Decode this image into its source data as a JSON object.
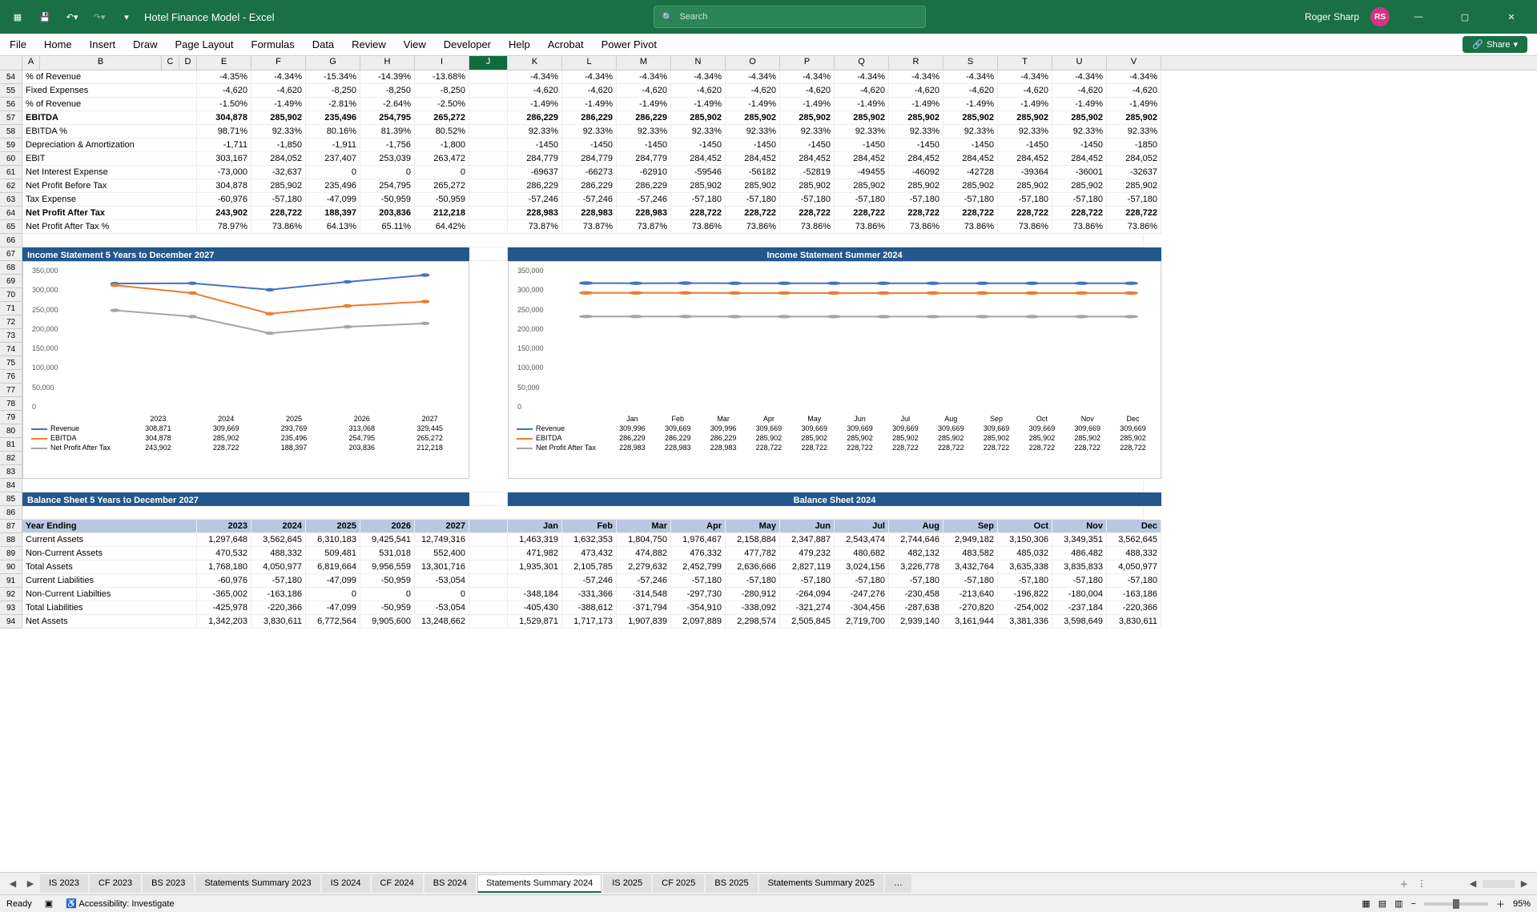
{
  "title_bar": {
    "app_name": "Hotel Finance Model  -  Excel",
    "search_placeholder": "Search",
    "user_name": "Roger Sharp",
    "user_initials": "RS"
  },
  "ribbon": {
    "tabs": [
      "File",
      "Home",
      "Insert",
      "Draw",
      "Page Layout",
      "Formulas",
      "Data",
      "Review",
      "View",
      "Developer",
      "Help",
      "Acrobat",
      "Power Pivot"
    ],
    "share_label": "Share"
  },
  "columns": {
    "letters": [
      "A",
      "B",
      "C",
      "D",
      "E",
      "F",
      "G",
      "H",
      "I",
      "J",
      "K",
      "L",
      "M",
      "N",
      "O",
      "P",
      "Q",
      "R",
      "S",
      "T",
      "U",
      "V"
    ],
    "widths": [
      22,
      152,
      22,
      22,
      68,
      68,
      68,
      68,
      68,
      48,
      68,
      68,
      68,
      68,
      68,
      68,
      68,
      68,
      68,
      68,
      68,
      68
    ],
    "selected": "J"
  },
  "row_numbers_top": [
    54,
    55,
    56,
    57,
    58,
    59,
    60,
    61,
    62,
    63,
    64,
    65,
    66,
    67,
    68,
    69,
    70,
    71,
    72,
    73,
    74,
    75,
    76,
    77,
    78,
    79,
    80,
    81,
    82,
    83,
    84,
    85,
    86,
    87,
    88,
    89,
    90,
    91,
    92,
    93,
    94
  ],
  "data_rows": [
    {
      "r": 54,
      "label": "% of Revenue",
      "vals": [
        "-4.35%",
        "-4.34%",
        "-15.34%",
        "-14.39%",
        "-13.68%",
        "",
        "-4.34%",
        "-4.34%",
        "-4.34%",
        "-4.34%",
        "-4.34%",
        "-4.34%",
        "-4.34%",
        "-4.34%",
        "-4.34%",
        "-4.34%",
        "-4.34%",
        "-4.34%"
      ]
    },
    {
      "r": 55,
      "label": "Fixed Expenses",
      "vals": [
        "-4,620",
        "-4,620",
        "-8,250",
        "-8,250",
        "-8,250",
        "",
        "-4,620",
        "-4,620",
        "-4,620",
        "-4,620",
        "-4,620",
        "-4,620",
        "-4,620",
        "-4,620",
        "-4,620",
        "-4,620",
        "-4,620",
        "-4,620"
      ]
    },
    {
      "r": 56,
      "label": "% of Revenue",
      "vals": [
        "-1.50%",
        "-1.49%",
        "-2.81%",
        "-2.64%",
        "-2.50%",
        "",
        "-1.49%",
        "-1.49%",
        "-1.49%",
        "-1.49%",
        "-1.49%",
        "-1.49%",
        "-1.49%",
        "-1.49%",
        "-1.49%",
        "-1.49%",
        "-1.49%",
        "-1.49%"
      ]
    },
    {
      "r": 57,
      "label": "EBITDA",
      "bold": true,
      "vals": [
        "304,878",
        "285,902",
        "235,496",
        "254,795",
        "265,272",
        "",
        "286,229",
        "286,229",
        "286,229",
        "285,902",
        "285,902",
        "285,902",
        "285,902",
        "285,902",
        "285,902",
        "285,902",
        "285,902",
        "285,902"
      ]
    },
    {
      "r": 58,
      "label": "EBITDA %",
      "vals": [
        "98.71%",
        "92.33%",
        "80.16%",
        "81.39%",
        "80.52%",
        "",
        "92.33%",
        "92.33%",
        "92.33%",
        "92.33%",
        "92.33%",
        "92.33%",
        "92.33%",
        "92.33%",
        "92.33%",
        "92.33%",
        "92.33%",
        "92.33%"
      ]
    },
    {
      "r": 59,
      "label": "Depreciation & Amortization",
      "vals": [
        "-1,711",
        "-1,850",
        "-1,911",
        "-1,756",
        "-1,800",
        "",
        "-1450",
        "-1450",
        "-1450",
        "-1450",
        "-1450",
        "-1450",
        "-1450",
        "-1450",
        "-1450",
        "-1450",
        "-1450",
        "-1850"
      ]
    },
    {
      "r": 60,
      "label": "EBIT",
      "vals": [
        "303,167",
        "284,052",
        "237,407",
        "253,039",
        "263,472",
        "",
        "284,779",
        "284,779",
        "284,779",
        "284,452",
        "284,452",
        "284,452",
        "284,452",
        "284,452",
        "284,452",
        "284,452",
        "284,452",
        "284,052"
      ]
    },
    {
      "r": 61,
      "label": "Net Interest Expense",
      "vals": [
        "-73,000",
        "-32,637",
        "0",
        "0",
        "0",
        "",
        "-69637",
        "-66273",
        "-62910",
        "-59546",
        "-56182",
        "-52819",
        "-49455",
        "-46092",
        "-42728",
        "-39364",
        "-36001",
        "-32637"
      ]
    },
    {
      "r": 62,
      "label": "Net Profit Before Tax",
      "vals": [
        "304,878",
        "285,902",
        "235,496",
        "254,795",
        "265,272",
        "",
        "286,229",
        "286,229",
        "286,229",
        "285,902",
        "285,902",
        "285,902",
        "285,902",
        "285,902",
        "285,902",
        "285,902",
        "285,902",
        "285,902"
      ]
    },
    {
      "r": 63,
      "label": "Tax Expense",
      "vals": [
        "-60,976",
        "-57,180",
        "-47,099",
        "-50,959",
        "-50,959",
        "",
        "-57,246",
        "-57,246",
        "-57,246",
        "-57,180",
        "-57,180",
        "-57,180",
        "-57,180",
        "-57,180",
        "-57,180",
        "-57,180",
        "-57,180",
        "-57,180"
      ]
    },
    {
      "r": 64,
      "label": "Net Profit After Tax",
      "bold": true,
      "vals": [
        "243,902",
        "228,722",
        "188,397",
        "203,836",
        "212,218",
        "",
        "228,983",
        "228,983",
        "228,983",
        "228,722",
        "228,722",
        "228,722",
        "228,722",
        "228,722",
        "228,722",
        "228,722",
        "228,722",
        "228,722"
      ]
    },
    {
      "r": 65,
      "label": "Net Profit After Tax %",
      "vals": [
        "78.97%",
        "73.86%",
        "64.13%",
        "65.11%",
        "64.42%",
        "",
        "73.87%",
        "73.87%",
        "73.87%",
        "73.86%",
        "73.86%",
        "73.86%",
        "73.86%",
        "73.86%",
        "73.86%",
        "73.86%",
        "73.86%",
        "73.86%"
      ]
    }
  ],
  "chart_left_header": "Income Statement 5 Years to December 2027",
  "chart_right_header": "Income Statement Summer 2024",
  "balance_left_header": "Balance Sheet 5 Years to December 2027",
  "balance_right_header": "Balance Sheet 2024",
  "balance_year_header": {
    "label": "Year Ending",
    "cols": [
      "2023",
      "2024",
      "2025",
      "2026",
      "2027",
      "",
      "Jan",
      "Feb",
      "Mar",
      "Apr",
      "May",
      "Jun",
      "Jul",
      "Aug",
      "Sep",
      "Oct",
      "Nov",
      "Dec"
    ]
  },
  "balance_rows": [
    {
      "r": 88,
      "label": "Current Assets",
      "vals": [
        "1,297,648",
        "3,562,645",
        "6,310,183",
        "9,425,541",
        "12,749,316",
        "",
        "1,463,319",
        "1,632,353",
        "1,804,750",
        "1,976,467",
        "2,158,884",
        "2,347,887",
        "2,543,474",
        "2,744,646",
        "2,949,182",
        "3,150,306",
        "3,349,351",
        "3,562,645"
      ]
    },
    {
      "r": 89,
      "label": "Non-Current Assets",
      "vals": [
        "470,532",
        "488,332",
        "509,481",
        "531,018",
        "552,400",
        "",
        "471,982",
        "473,432",
        "474,882",
        "476,332",
        "477,782",
        "479,232",
        "480,682",
        "482,132",
        "483,582",
        "485,032",
        "486,482",
        "488,332"
      ]
    },
    {
      "r": 90,
      "label": "Total Assets",
      "vals": [
        "1,768,180",
        "4,050,977",
        "6,819,664",
        "9,956,559",
        "13,301,716",
        "",
        "1,935,301",
        "2,105,785",
        "2,279,632",
        "2,452,799",
        "2,636,666",
        "2,827,119",
        "3,024,156",
        "3,226,778",
        "3,432,764",
        "3,635,338",
        "3,835,833",
        "4,050,977"
      ]
    },
    {
      "r": 91,
      "label": "Current Liabilities",
      "vals": [
        "-60,976",
        "-57,180",
        "-47,099",
        "-50,959",
        "-53,054",
        "",
        "",
        "-57,246",
        "-57,246",
        "-57,180",
        "-57,180",
        "-57,180",
        "-57,180",
        "-57,180",
        "-57,180",
        "-57,180",
        "-57,180",
        "-57,180"
      ]
    },
    {
      "r": 92,
      "label": "Non-Current Liabilties",
      "vals": [
        "-365,002",
        "-163,186",
        "0",
        "0",
        "0",
        "",
        "-348,184",
        "-331,366",
        "-314,548",
        "-297,730",
        "-280,912",
        "-264,094",
        "-247,276",
        "-230,458",
        "-213,640",
        "-196,822",
        "-180,004",
        "-163,186"
      ]
    },
    {
      "r": 93,
      "label": "Total Liabilities",
      "vals": [
        "-425,978",
        "-220,366",
        "-47,099",
        "-50,959",
        "-53,054",
        "",
        "-405,430",
        "-388,612",
        "-371,794",
        "-354,910",
        "-338,092",
        "-321,274",
        "-304,456",
        "-287,638",
        "-270,820",
        "-254,002",
        "-237,184",
        "-220,366"
      ]
    },
    {
      "r": 94,
      "label": "Net Assets",
      "vals": [
        "1,342,203",
        "3,830,611",
        "6,772,564",
        "9,905,600",
        "13,248,662",
        "",
        "1,529,871",
        "1,717,173",
        "1,907,839",
        "2,097,889",
        "2,298,574",
        "2,505,845",
        "2,719,700",
        "2,939,140",
        "3,161,944",
        "3,381,336",
        "3,598,649",
        "3,830,611"
      ]
    }
  ],
  "chart_data": [
    {
      "type": "line",
      "title": "Income Statement 5 Years to December 2027",
      "categories": [
        "2023",
        "2024",
        "2025",
        "2026",
        "2027"
      ],
      "series": [
        {
          "name": "Revenue",
          "color": "#4472c4",
          "values": [
            308871,
            309669,
            293769,
            313068,
            329445
          ]
        },
        {
          "name": "EBITDA",
          "color": "#ed7d31",
          "values": [
            304878,
            285902,
            235496,
            254795,
            265272
          ]
        },
        {
          "name": "Net Profit After Tax",
          "color": "#a5a5a5",
          "values": [
            243902,
            228722,
            188397,
            203836,
            212218
          ]
        }
      ],
      "ylim": [
        0,
        350000
      ],
      "yticks": [
        0,
        50000,
        100000,
        150000,
        200000,
        250000,
        300000,
        350000
      ]
    },
    {
      "type": "line",
      "title": "Income Statement Summer 2024",
      "categories": [
        "Jan",
        "Feb",
        "Mar",
        "Apr",
        "May",
        "Jun",
        "Jul",
        "Aug",
        "Sep",
        "Oct",
        "Nov",
        "Dec"
      ],
      "series": [
        {
          "name": "Revenue",
          "color": "#4472c4",
          "values": [
            309996,
            309669,
            309996,
            309669,
            309669,
            309669,
            309669,
            309669,
            309669,
            309669,
            309669,
            309669
          ]
        },
        {
          "name": "EBITDA",
          "color": "#ed7d31",
          "values": [
            286229,
            286229,
            286229,
            285902,
            285902,
            285902,
            285902,
            285902,
            285902,
            285902,
            285902,
            285902
          ]
        },
        {
          "name": "Net Profit After Tax",
          "color": "#a5a5a5",
          "values": [
            228983,
            228983,
            228983,
            228722,
            228722,
            228722,
            228722,
            228722,
            228722,
            228722,
            228722,
            228722
          ]
        }
      ],
      "ylim": [
        0,
        350000
      ],
      "yticks": [
        0,
        50000,
        100000,
        150000,
        200000,
        250000,
        300000,
        350000
      ]
    }
  ],
  "sheet_tabs": {
    "items": [
      "IS 2023",
      "CF 2023",
      "BS 2023",
      "Statements Summary 2023",
      "IS 2024",
      "CF 2024",
      "BS 2024",
      "Statements Summary 2024",
      "IS 2025",
      "CF 2025",
      "BS 2025",
      "Statements Summary 2025",
      "…"
    ],
    "active_index": 7
  },
  "status_bar": {
    "ready": "Ready",
    "accessibility": "Accessibility: Investigate",
    "zoom": "95%"
  }
}
